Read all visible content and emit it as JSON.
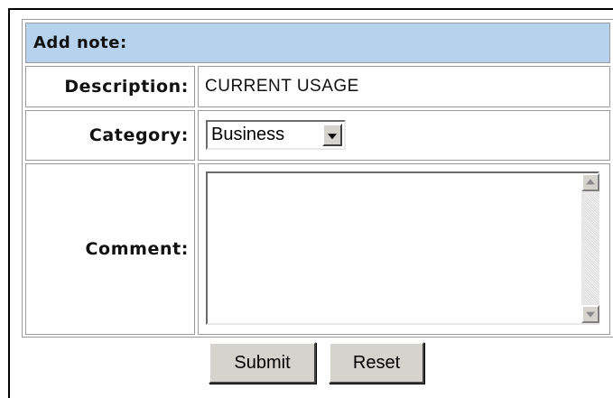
{
  "form": {
    "title": "Add note:",
    "description": {
      "label": "Description:",
      "value": "CURRENT USAGE"
    },
    "category": {
      "label": "Category:",
      "selected": "Business"
    },
    "comment": {
      "label": "Comment:",
      "value": ""
    },
    "buttons": {
      "submit": "Submit",
      "reset": "Reset"
    }
  },
  "colors": {
    "header_bg": "#b7d2ec",
    "button_face": "#d6d3ce",
    "border": "#9a9a9a"
  }
}
